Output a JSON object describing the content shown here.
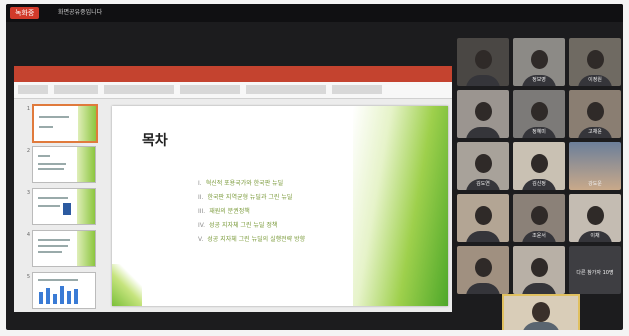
{
  "topbar": {
    "rec_label": "녹화중",
    "share_note": "화면공유중입니다"
  },
  "slide": {
    "title": "목차",
    "items": [
      {
        "num": "I.",
        "text": "혁신적 포용국가와 한국판 뉴딜"
      },
      {
        "num": "II.",
        "text": "한국판 지역균형 뉴딜과 그린 뉴딜"
      },
      {
        "num": "III.",
        "text": "재원의 분권정책"
      },
      {
        "num": "IV.",
        "text": "성공 지자체 그린 뉴딜 정책"
      },
      {
        "num": "V.",
        "text": "성공 지자체 그린 뉴딜의 실행전략 방향"
      }
    ]
  },
  "thumbnail_numbers": [
    "1",
    "2",
    "3",
    "4",
    "5"
  ],
  "participants": [
    {
      "name": ""
    },
    {
      "name": "정보영"
    },
    {
      "name": "이정원"
    },
    {
      "name": ""
    },
    {
      "name": "정혜미"
    },
    {
      "name": "고채윤"
    },
    {
      "name": "김도연"
    },
    {
      "name": "김신정"
    },
    {
      "name": "강도운"
    },
    {
      "name": ""
    },
    {
      "name": "조윤서"
    },
    {
      "name": "이채"
    },
    {
      "name": ""
    },
    {
      "name": ""
    },
    {
      "name": "다른 참가자 10명"
    }
  ],
  "colors": {
    "accent_green": "#8cc63f",
    "ppt_red": "#c4432f",
    "speaker_border": "#e0c060"
  }
}
